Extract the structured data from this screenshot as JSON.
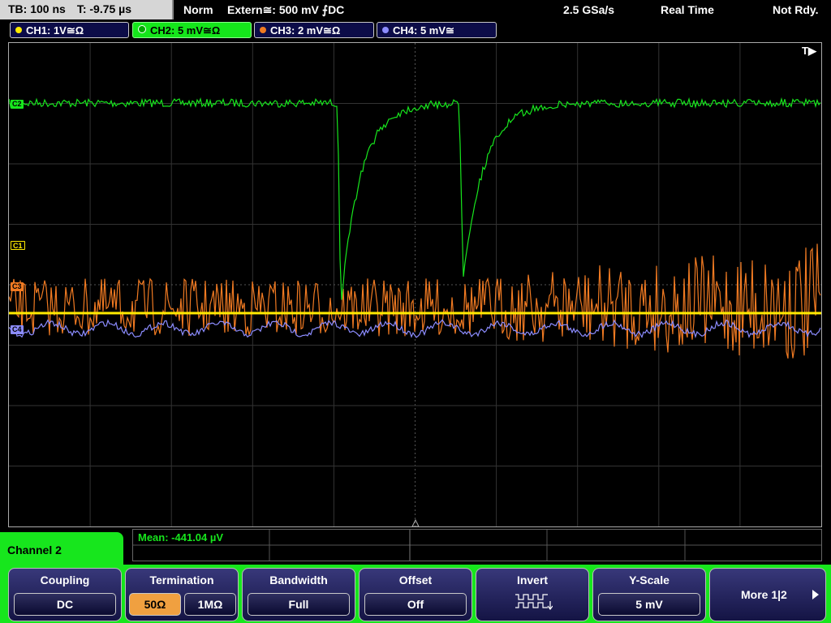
{
  "status": {
    "timebase": "TB: 100 ns",
    "trigger_time": "T: -9.75 µs",
    "mode": "Norm",
    "trigger_source": "Extern≅: 500 mV ⨍DC",
    "sample_rate": "2.5 GSa/s",
    "acq_mode": "Real Time",
    "ready_state": "Not Rdy."
  },
  "channels": [
    {
      "label": "CH1: 1V≅Ω",
      "color": "#ffeb00"
    },
    {
      "label": "CH2: 5 mV≅Ω",
      "color": "#17e61d"
    },
    {
      "label": "CH3: 2 mV≅Ω",
      "color": "#f07a22"
    },
    {
      "label": "CH4: 5 mV≅",
      "color": "#8c8cff"
    }
  ],
  "markers": {
    "c2": "C2",
    "c1": "C1",
    "c3": "C3",
    "c4": "C4"
  },
  "trigger_marker": "T▶",
  "measurement": {
    "mean": "Mean: -441.04 µV"
  },
  "panel_title": "Channel 2",
  "softkeys": {
    "coupling": {
      "label": "Coupling",
      "value": "DC"
    },
    "termination": {
      "label": "Termination",
      "opt1": "50Ω",
      "opt2": "1MΩ"
    },
    "bandwidth": {
      "label": "Bandwidth",
      "value": "Full"
    },
    "offset": {
      "label": "Offset",
      "value": "Off"
    },
    "invert": {
      "label": "Invert"
    },
    "yscale": {
      "label": "Y-Scale",
      "value": "5 mV"
    },
    "more": {
      "label": "More 1|2"
    }
  }
}
